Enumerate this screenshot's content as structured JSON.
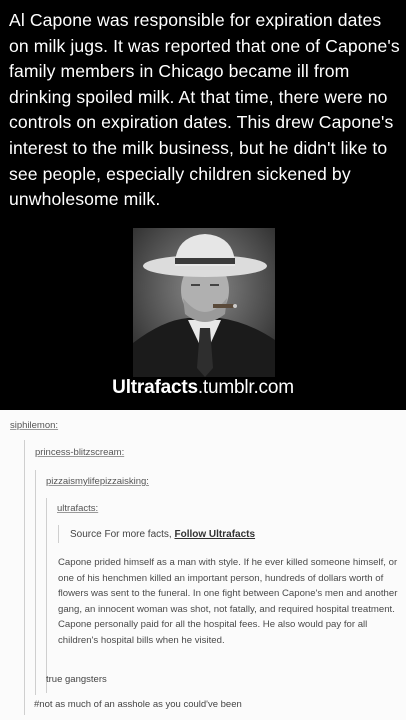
{
  "poster": {
    "text": "Al Capone was responsible for expiration dates on milk jugs. It was reported that one of Capone's family members in Chicago became ill from drinking spoiled milk. At that time, there were no controls on expiration dates. This drew Capone's interest to the milk business,  but he didn't like to see people, especially children sickened by unwholesome milk.",
    "brand_bold": "Ultrafacts",
    "brand_suffix": ".tumblr.com",
    "background": "#000000"
  },
  "thread": {
    "users": [
      "siphilemon:",
      "princess-blitzscream:",
      "pizzaismylifepizzaisking:",
      "ultrafacts:"
    ],
    "source_prefix": "Source For more facts,",
    "source_link": "Follow Ultrafacts",
    "quote": "Capone prided himself as a man with style. If he ever killed someone himself, or one of his henchmen killed an important person, hundreds of dollars worth of flowers was sent to the funeral. In one fight between Capone's men and another gang, an innocent woman was shot, not fatally, and required hospital treatment. Capone personally paid for all the hospital fees. He also would pay for all children's hospital bills when he visited.",
    "reply_1": "true gangsters",
    "reply_2": "#not as much of an asshole as you could've been"
  }
}
